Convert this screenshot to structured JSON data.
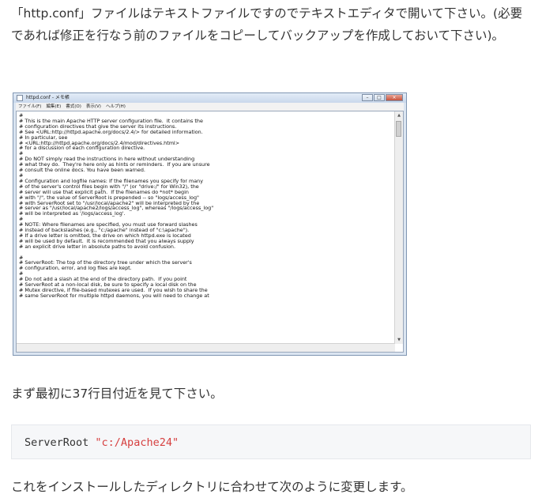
{
  "paragraphs": {
    "intro": "「http.conf」ファイルはテキストファイルですのでテキストエディタで開いて下さい。(必要であれば修正を行なう前のファイルをコピーしてバックアップを作成しておいて下さい)。",
    "line37": "まず最初に37行目付近を見て下さい。",
    "change": "これをインストールしたディレクトリに合わせて次のように変更します。"
  },
  "notepad": {
    "title": "httpd.conf - メモ帳",
    "menu": [
      "ファイル(F)",
      "編集(E)",
      "書式(O)",
      "表示(V)",
      "ヘルプ(H)"
    ],
    "content": "#\n# This is the main Apache HTTP server configuration file.  It contains the\n# configuration directives that give the server its instructions.\n# See <URL:http://httpd.apache.org/docs/2.4/> for detailed information.\n# In particular, see\n# <URL:http://httpd.apache.org/docs/2.4/mod/directives.html>\n# for a discussion of each configuration directive.\n#\n# Do NOT simply read the instructions in here without understanding\n# what they do.  They're here only as hints or reminders.  If you are unsure\n# consult the online docs. You have been warned.\n#\n# Configuration and logfile names: If the filenames you specify for many\n# of the server's control files begin with \"/\" (or \"drive:/\" for Win32), the\n# server will use that explicit path.  If the filenames do *not* begin\n# with \"/\", the value of ServerRoot is prepended -- so \"logs/access_log\"\n# with ServerRoot set to \"/usr/local/apache2\" will be interpreted by the\n# server as \"/usr/local/apache2/logs/access_log\", whereas \"/logs/access_log\"\n# will be interpreted as '/logs/access_log'.\n#\n# NOTE: Where filenames are specified, you must use forward slashes\n# instead of backslashes (e.g., \"c:/apache\" instead of \"c:\\apache\").\n# If a drive letter is omitted, the drive on which httpd.exe is located\n# will be used by default.  It is recommended that you always supply\n# an explicit drive letter in absolute paths to avoid confusion.\n\n#\n# ServerRoot: The top of the directory tree under which the server's\n# configuration, error, and log files are kept.\n#\n# Do not add a slash at the end of the directory path.  If you point\n# ServerRoot at a non-local disk, be sure to specify a local disk on the\n# Mutex directive, if file-based mutexes are used.  If you wish to share the\n# same ServerRoot for multiple httpd daemons, you will need to change at"
  },
  "code": {
    "directive": "ServerRoot",
    "value": "\"c:/Apache24\""
  },
  "colors": {
    "string": "#d64040",
    "code_bg": "#f6f7f9"
  }
}
